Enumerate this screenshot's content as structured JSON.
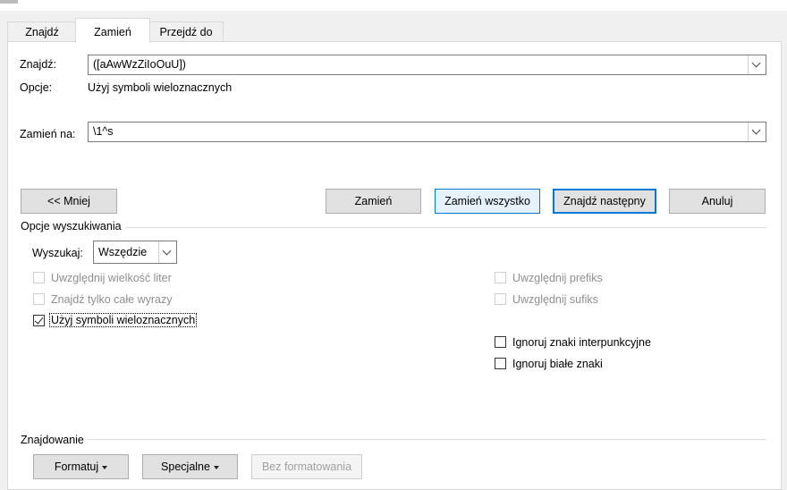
{
  "tabs": [
    {
      "label": "Znajdź"
    },
    {
      "label": "Zamień"
    },
    {
      "label": "Przejdź do"
    }
  ],
  "find": {
    "label": "Znajdź:",
    "value": "([aAwWzZiIoOuU])",
    "options_label": "Opcje:",
    "options_value": "Użyj symboli wieloznacznych"
  },
  "replace": {
    "label": "Zamień na:",
    "value": "\\1^s"
  },
  "buttons": {
    "less": "<< Mniej",
    "replace": "Zamień",
    "replace_all": "Zamień wszystko",
    "find_next": "Znajdź następny",
    "cancel": "Anuluj"
  },
  "search_options": {
    "heading": "Opcje wyszukiwania",
    "search_label": "Wyszukaj:",
    "search_value": "Wszędzie",
    "left_checks": [
      {
        "label": "Uwzględnij wielkość liter",
        "checked": false,
        "enabled": false
      },
      {
        "label": "Znajdź tylko całe wyrazy",
        "checked": false,
        "enabled": false
      },
      {
        "label": "Użyj symboli wieloznacznych",
        "checked": true,
        "enabled": true
      }
    ],
    "right_checks": [
      {
        "label": "Uwzględnij prefiks",
        "checked": false,
        "enabled": false
      },
      {
        "label": "Uwzględnij sufiks",
        "checked": false,
        "enabled": false
      },
      {
        "label": "Ignoruj znaki interpunkcyjne",
        "checked": false,
        "enabled": true
      },
      {
        "label": "Ignoruj białe znaki",
        "checked": false,
        "enabled": true
      }
    ]
  },
  "finding": {
    "heading": "Znajdowanie",
    "format": "Formatuj",
    "special": "Specjalne",
    "no_format": "Bez formatowania"
  }
}
